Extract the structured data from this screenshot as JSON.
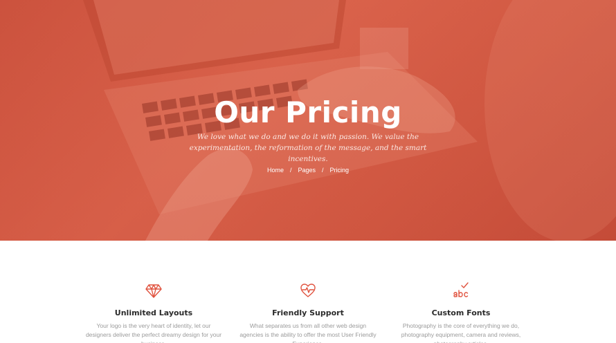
{
  "hero": {
    "title": "Our Pricing",
    "subtitle": "We love what we do and we do it with passion. We value the experimentation, the reformation of the message, and the smart incentives.",
    "breadcrumb": {
      "home": "Home",
      "pages": "Pages",
      "current": "Pricing",
      "separator": "/"
    }
  },
  "features": [
    {
      "icon": "diamond-icon",
      "title": "Unlimited Layouts",
      "text": "Your logo is the very heart of  identity, let our designers deliver the perfect dreamy design for your business."
    },
    {
      "icon": "heart-pulse-icon",
      "title": "Friendly Support",
      "text": "What separates us from all other web design agencies is the ability to offer the most User Friendly Experience."
    },
    {
      "icon": "abc-check-icon",
      "title": "Custom Fonts",
      "text": "Photography is the core of everything we do, photography equipment, camera and reviews, photography articles."
    }
  ],
  "colors": {
    "accent": "#e0533f",
    "hero_overlay": "#d55a44"
  }
}
